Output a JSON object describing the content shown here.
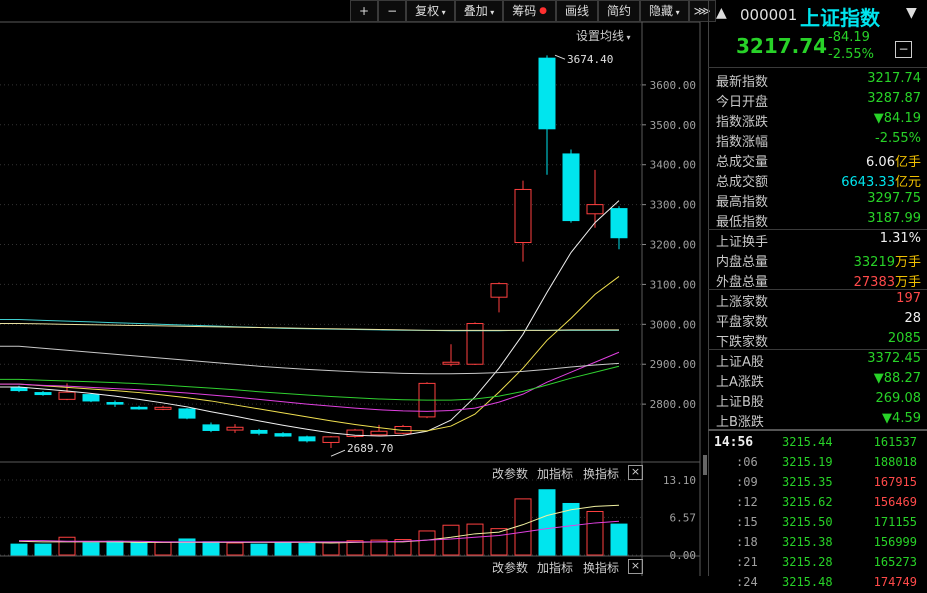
{
  "toolbar": {
    "plus": "+",
    "minus": "−",
    "fuquan": "复权",
    "diejia": "叠加",
    "chouma": "筹码",
    "huaxian": "画线",
    "jianyue": "简约",
    "yincang": "隐藏",
    "expand": "⋙"
  },
  "chart_header": {
    "ma_setting": "设置均线"
  },
  "colors": {
    "up": "#ff4040",
    "down": "#00e5ee",
    "green_text": "#28d228",
    "red_text": "#ff4a4a",
    "gold": "#f0c000"
  },
  "chart_data": [
    {
      "type": "candlestick",
      "y_ticks": [
        "3600.00",
        "3500.00",
        "3400.00",
        "3300.00",
        "3200.00",
        "3100.00",
        "3000.00",
        "2900.00",
        "2800.00"
      ],
      "ylim": [
        2660,
        3700
      ],
      "annotations": {
        "high": "3674.40",
        "low": "2689.70"
      },
      "candles": [
        {
          "o": 2841,
          "h": 2846,
          "l": 2830,
          "c": 2834
        },
        {
          "o": 2829,
          "h": 2833,
          "l": 2821,
          "c": 2824
        },
        {
          "o": 2812,
          "h": 2852,
          "l": 2810,
          "c": 2830
        },
        {
          "o": 2824,
          "h": 2828,
          "l": 2805,
          "c": 2808
        },
        {
          "o": 2804,
          "h": 2809,
          "l": 2793,
          "c": 2800
        },
        {
          "o": 2792,
          "h": 2796,
          "l": 2786,
          "c": 2788
        },
        {
          "o": 2787,
          "h": 2796,
          "l": 2785,
          "c": 2792
        },
        {
          "o": 2788,
          "h": 2790,
          "l": 2762,
          "c": 2765
        },
        {
          "o": 2748,
          "h": 2754,
          "l": 2730,
          "c": 2734
        },
        {
          "o": 2735,
          "h": 2750,
          "l": 2728,
          "c": 2742
        },
        {
          "o": 2734,
          "h": 2738,
          "l": 2722,
          "c": 2727
        },
        {
          "o": 2726,
          "h": 2730,
          "l": 2718,
          "c": 2720
        },
        {
          "o": 2718,
          "h": 2721,
          "l": 2704,
          "c": 2708
        },
        {
          "o": 2704,
          "h": 2720,
          "l": 2690,
          "c": 2718
        },
        {
          "o": 2719,
          "h": 2738,
          "l": 2716,
          "c": 2735
        },
        {
          "o": 2723,
          "h": 2748,
          "l": 2720,
          "c": 2732
        },
        {
          "o": 2727,
          "h": 2748,
          "l": 2725,
          "c": 2744
        },
        {
          "o": 2768,
          "h": 2855,
          "l": 2765,
          "c": 2852
        },
        {
          "o": 2900,
          "h": 2950,
          "l": 2895,
          "c": 2905
        },
        {
          "o": 2900,
          "h": 3005,
          "l": 2898,
          "c": 3002
        },
        {
          "o": 3068,
          "h": 3105,
          "l": 3030,
          "c": 3102
        },
        {
          "o": 3205,
          "h": 3360,
          "l": 3157,
          "c": 3338
        },
        {
          "o": 3667,
          "h": 3674,
          "l": 3375,
          "c": 3490
        },
        {
          "o": 3427,
          "h": 3438,
          "l": 3255,
          "c": 3260
        },
        {
          "o": 3277,
          "h": 3387,
          "l": 3242,
          "c": 3300
        },
        {
          "o": 3290,
          "h": 3296,
          "l": 3188,
          "c": 3217
        }
      ],
      "ma_series": [
        {
          "color": "#f0f0f0",
          "values": [
            2843,
            2838,
            2833,
            2827,
            2820,
            2812,
            2803,
            2793,
            2781,
            2770,
            2758,
            2747,
            2737,
            2728,
            2722,
            2720,
            2722,
            2732,
            2760,
            2818,
            2890,
            2975,
            3080,
            3180,
            3255,
            3310
          ]
        },
        {
          "color": "#f0e050",
          "values": [
            2850,
            2846,
            2842,
            2838,
            2834,
            2829,
            2823,
            2816,
            2808,
            2798,
            2788,
            2778,
            2768,
            2758,
            2749,
            2741,
            2734,
            2733,
            2745,
            2775,
            2830,
            2890,
            2960,
            3015,
            3075,
            3120
          ]
        },
        {
          "color": "#e040e0",
          "values": [
            2850,
            2847,
            2845,
            2842,
            2839,
            2836,
            2832,
            2828,
            2823,
            2818,
            2812,
            2806,
            2800,
            2795,
            2790,
            2786,
            2783,
            2782,
            2784,
            2790,
            2805,
            2825,
            2855,
            2880,
            2905,
            2930
          ]
        },
        {
          "color": "#30d030",
          "values": [
            2862,
            2860,
            2858,
            2856,
            2854,
            2851,
            2848,
            2844,
            2840,
            2836,
            2831,
            2827,
            2823,
            2819,
            2816,
            2813,
            2811,
            2810,
            2810,
            2813,
            2820,
            2832,
            2848,
            2865,
            2880,
            2895
          ]
        },
        {
          "color": "#c8c8c8",
          "values": [
            2945,
            2940,
            2935,
            2930,
            2925,
            2920,
            2915,
            2910,
            2905,
            2900,
            2895,
            2891,
            2887,
            2884,
            2881,
            2879,
            2877,
            2876,
            2876,
            2877,
            2879,
            2882,
            2887,
            2893,
            2898,
            2902
          ]
        },
        {
          "color": "#40d0d0",
          "values": [
            3012,
            3010,
            3008,
            3006,
            3004,
            3002,
            3000,
            2998,
            2996,
            2994,
            2992,
            2990,
            2989,
            2988,
            2987,
            2986,
            2985,
            2985,
            2984,
            2984,
            2984,
            2985,
            2985,
            2985,
            2985,
            2985
          ]
        },
        {
          "color": "#e8e0a0",
          "values": [
            3002,
            3001,
            3000,
            2999,
            2998,
            2997,
            2996,
            2995,
            2994,
            2993,
            2992,
            2991,
            2990,
            2989,
            2988,
            2987,
            2986,
            2985,
            2985,
            2985,
            2985,
            2985,
            2985,
            2986,
            2986,
            2986
          ]
        }
      ]
    },
    {
      "type": "bar",
      "y_ticks": [
        "13.10",
        "6.57",
        "0.00"
      ],
      "ylim": [
        0,
        13.1
      ],
      "values": [
        1.9,
        1.9,
        3.1,
        2.1,
        2.4,
        2.1,
        2.2,
        2.8,
        2.3,
        2.1,
        1.9,
        2.1,
        2.0,
        2.2,
        2.5,
        2.6,
        2.7,
        4.2,
        5.2,
        5.4,
        4.6,
        9.8,
        11.4,
        9.0,
        7.6,
        5.4
      ],
      "ma_series": [
        {
          "color": "#f0f0a0",
          "values": [
            2.4,
            2.3,
            2.3,
            2.3,
            2.3,
            2.2,
            2.2,
            2.2,
            2.2,
            2.2,
            2.2,
            2.2,
            2.2,
            2.1,
            2.2,
            2.3,
            2.3,
            2.6,
            3.1,
            3.7,
            4.0,
            5.3,
            6.9,
            7.9,
            8.5,
            8.7
          ]
        },
        {
          "color": "#e040e0",
          "values": [
            2.5,
            2.5,
            2.4,
            2.4,
            2.4,
            2.4,
            2.3,
            2.3,
            2.3,
            2.3,
            2.3,
            2.3,
            2.3,
            2.3,
            2.3,
            2.3,
            2.4,
            2.6,
            2.8,
            3.1,
            3.4,
            4.0,
            4.6,
            5.1,
            5.6,
            5.9
          ]
        }
      ]
    }
  ],
  "sub_labels": {
    "gai_canshu": "改参数",
    "jia_zhibiao": "加指标",
    "huan_zhibiao": "换指标",
    "close": "×"
  },
  "right_panel": {
    "code": "000001",
    "name": "上证指数",
    "price": "3217.74",
    "change": "-84.19",
    "change_pct": "-2.55%",
    "collapse": "−",
    "stats": [
      {
        "label": "最新指数",
        "value": "3217.74",
        "color": "#28d228"
      },
      {
        "label": "今日开盘",
        "value": "3287.87",
        "color": "#28d228"
      },
      {
        "label": "指数涨跌",
        "value": "▼84.19",
        "color": "#28d228"
      },
      {
        "label": "指数涨幅",
        "value": "-2.55%",
        "color": "#28d228"
      },
      {
        "label": "总成交量",
        "value": "6.06",
        "unit": "亿手",
        "color": "#f0f0f0",
        "unit_color": "#f0c000"
      },
      {
        "label": "总成交额",
        "value": "6643.33",
        "unit": "亿元",
        "color": "#00e5ee",
        "unit_color": "#f0c000"
      },
      {
        "label": "最高指数",
        "value": "3297.75",
        "color": "#28d228"
      },
      {
        "label": "最低指数",
        "value": "3187.99",
        "color": "#28d228"
      },
      {
        "label": "上证换手",
        "value": "1.31%",
        "color": "#f0f0f0",
        "sep": true
      },
      {
        "label": "内盘总量",
        "value": "33219",
        "unit": "万手",
        "color": "#28d228",
        "unit_color": "#f0c000"
      },
      {
        "label": "外盘总量",
        "value": "27383",
        "unit": "万手",
        "color": "#ff4a4a",
        "unit_color": "#f0c000"
      },
      {
        "label": "上涨家数",
        "value": "197",
        "color": "#ff4a4a",
        "sep": true
      },
      {
        "label": "平盘家数",
        "value": "28",
        "color": "#f0f0f0"
      },
      {
        "label": "下跌家数",
        "value": "2085",
        "color": "#28d228"
      },
      {
        "label": "上证A股",
        "value": "3372.45",
        "color": "#28d228",
        "sep": true
      },
      {
        "label": "上A涨跌",
        "value": "▼88.27",
        "color": "#28d228"
      },
      {
        "label": "上证B股",
        "value": "269.08",
        "color": "#28d228"
      },
      {
        "label": "上B涨跌",
        "value": "▼4.59",
        "color": "#28d228"
      }
    ],
    "ticks": [
      {
        "time": "14:56",
        "price": "3215.44",
        "vol": "161537",
        "vcolor": "#28d228"
      },
      {
        "time": ":06",
        "price": "3215.19",
        "vol": "188018",
        "vcolor": "#28d228"
      },
      {
        "time": ":09",
        "price": "3215.35",
        "vol": "167915",
        "vcolor": "#ff4a4a"
      },
      {
        "time": ":12",
        "price": "3215.62",
        "vol": "156469",
        "vcolor": "#ff4a4a"
      },
      {
        "time": ":15",
        "price": "3215.50",
        "vol": "171155",
        "vcolor": "#28d228"
      },
      {
        "time": ":18",
        "price": "3215.38",
        "vol": "156999",
        "vcolor": "#28d228"
      },
      {
        "time": ":21",
        "price": "3215.28",
        "vol": "165273",
        "vcolor": "#28d228"
      },
      {
        "time": ":24",
        "price": "3215.48",
        "vol": "174749",
        "vcolor": "#ff4a4a"
      }
    ]
  }
}
